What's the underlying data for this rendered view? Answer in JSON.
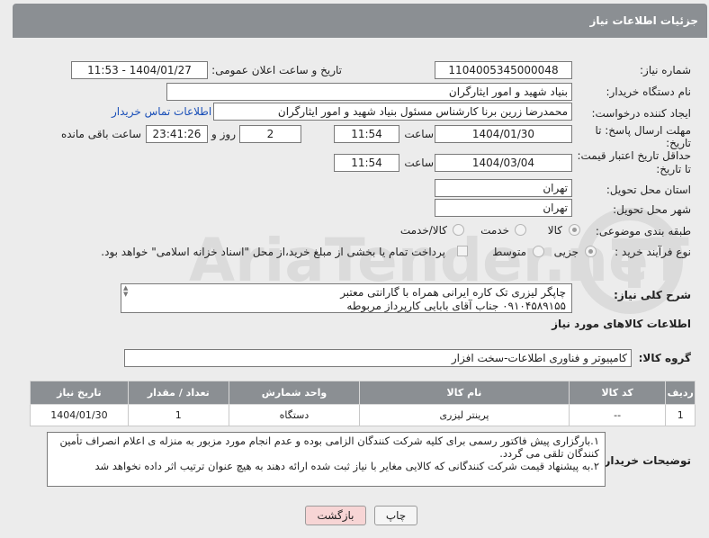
{
  "header": {
    "title": "جزئیات اطلاعات نیاز"
  },
  "need_number": {
    "label": "شماره نیاز:",
    "value": "1104005345000048"
  },
  "announce": {
    "label": "تاریخ و ساعت اعلان عمومی:",
    "value": "1404/01/27 - 11:53"
  },
  "buyer_org": {
    "label": "نام دستگاه خریدار:",
    "value": "بنیاد شهید و امور ایثارگران"
  },
  "creator": {
    "label": "ایجاد کننده درخواست:",
    "value": "محمدرضا زرین برنا کارشناس مسئول  بنیاد شهید و امور ایثارگران",
    "contact_link": "اطلاعات تماس خریدار"
  },
  "deadline": {
    "label_line1": "مهلت ارسال پاسخ: تا",
    "label_line2": "تاریخ:",
    "date": "1404/01/30",
    "time_label": "ساعت",
    "time": "11:54",
    "days": "2",
    "days_label": "روز و",
    "remaining": "23:41:26",
    "remaining_label": "ساعت باقی مانده"
  },
  "validity": {
    "label_line1": "حداقل تاریخ اعتبار قیمت:",
    "label_line2": "تا تاریخ:",
    "date": "1404/03/04",
    "time_label": "ساعت",
    "time": "11:54"
  },
  "province": {
    "label": "استان محل تحویل:",
    "value": "تهران"
  },
  "city": {
    "label": "شهر محل تحویل:",
    "value": "تهران"
  },
  "category": {
    "label": "طبقه بندی موضوعی:",
    "options": [
      "کالا",
      "خدمت",
      "کالا/خدمت"
    ],
    "selected": "کالا"
  },
  "process": {
    "label": "نوع فرآیند خرید :",
    "options": [
      "جزیی",
      "متوسط"
    ],
    "selected": "جزیی",
    "checkbox_text": "پرداخت تمام یا بخشی از مبلغ خرید،از محل \"اسناد خزانه اسلامی\" خواهد بود."
  },
  "description": {
    "label": "شرح کلی نیاز:",
    "line1": "چاپگر لیزری تک کاره ایرانی همراه با گارانتی معتبر",
    "line2": "۰۹۱۰۴۵۸۹۱۵۵ جناب آقای بابایی کارپرداز مربوطه"
  },
  "items_section": {
    "title": "اطلاعات کالاهای مورد نیاز"
  },
  "goods_group": {
    "label": "گروه کالا:",
    "value": "کامپیوتر و فناوری اطلاعات-سخت افزار"
  },
  "table": {
    "headers": [
      "ردیف",
      "کد کالا",
      "نام کالا",
      "واحد شمارش",
      "تعداد / مقدار",
      "تاریخ نیاز"
    ],
    "rows": [
      [
        "1",
        "--",
        "پرینتر لیزری",
        "دستگاه",
        "1",
        "1404/01/30"
      ]
    ]
  },
  "buyer_notes": {
    "label": "توضیحات خریدار:",
    "line1": "۱.بارگزاری پیش فاکتور رسمی برای کلیه شرکت کنندگان الزامی بوده و عدم انجام مورد مزبور به منزله ی اعلام انصراف تأمین",
    "line2": "کنندگان تلقی می گردد.",
    "line3": "۲.به پیشنهاد قیمت شرکت کنندگانی که کالایی مغایر با نیاز ثبت شده ارائه دهند به هیچ عنوان ترتیب اثر داده نخواهد شد"
  },
  "buttons": {
    "print": "چاپ",
    "back": "بازگشت"
  },
  "watermark": {
    "text": "AriaTender.neT"
  }
}
